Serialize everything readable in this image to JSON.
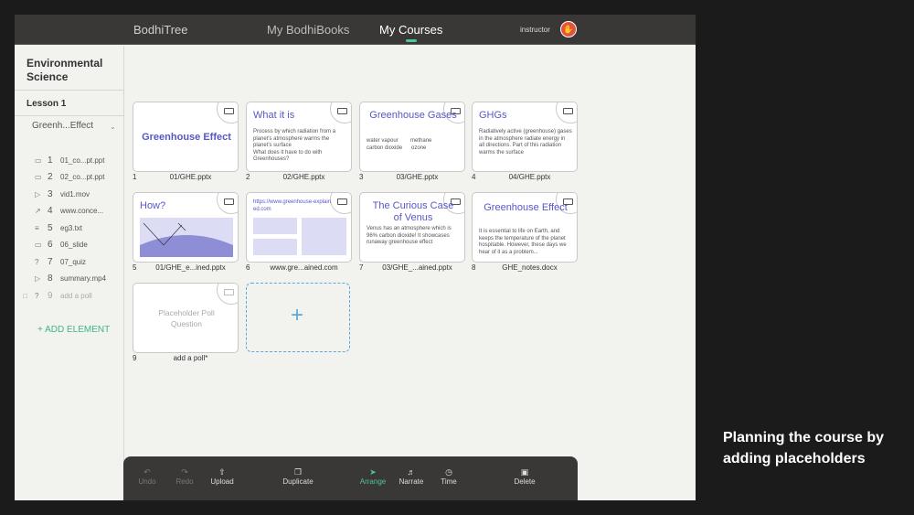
{
  "header": {
    "brand": "BodhiTree",
    "nav": [
      "My BodhiBooks",
      "My Courses"
    ],
    "user_label": "instructor"
  },
  "sidebar": {
    "course_title": "Environmental Science",
    "lesson": "Lesson 1",
    "group": "Greenh...Effect",
    "items": [
      {
        "num": "1",
        "label": "01_co...pt.ppt",
        "icon": "slides-icon"
      },
      {
        "num": "2",
        "label": "02_co...pt.ppt",
        "icon": "slides-icon"
      },
      {
        "num": "3",
        "label": "vid1.mov",
        "icon": "play-icon"
      },
      {
        "num": "4",
        "label": "www.conce...",
        "icon": "link-icon"
      },
      {
        "num": "5",
        "label": "eg3.txt",
        "icon": "text-icon"
      },
      {
        "num": "6",
        "label": "06_slide",
        "icon": "slides-icon"
      },
      {
        "num": "7",
        "label": "07_quiz",
        "icon": "quiz-icon"
      },
      {
        "num": "8",
        "label": "summary.mp4",
        "icon": "play-icon"
      },
      {
        "num": "9",
        "label": "add a poll",
        "icon": "quiz-icon"
      }
    ],
    "add_element": "+ ADD ELEMENT"
  },
  "cards": [
    {
      "num": "1",
      "name": "01/GHE.pptx",
      "title": "Greenhouse Effect",
      "body": ""
    },
    {
      "num": "2",
      "name": "02/GHE.pptx",
      "title": "What it is",
      "body": "Process by which radiation from a planet's atmosphere warms the planet's surface\nWhat does it have to do with Greenhouses?"
    },
    {
      "num": "3",
      "name": "03/GHE.pptx",
      "title": "Greenhouse Gases",
      "body": "water vapour        methane\ncarbon dioxide      ozone"
    },
    {
      "num": "4",
      "name": "04/GHE.pptx",
      "title": "GHGs",
      "body": "Radiatively active (greenhouse) gases in the atmosphere radiate energy in all directions. Part of this radiation warms the surface"
    },
    {
      "num": "5",
      "name": "01/GHE_e...ined.pptx",
      "title": "How?",
      "body": ""
    },
    {
      "num": "6",
      "name": "www.gre...ained.com",
      "title": "https://www.greenhouse-explained.com",
      "body": ""
    },
    {
      "num": "7",
      "name": "03/GHE_...ained.pptx",
      "title": "The Curious Case of Venus",
      "body": "Venus has an atmosphere which is 96% carbon dioxide! It showcases runaway greenhouse effect"
    },
    {
      "num": "8",
      "name": "GHE_notes.docx",
      "title": "Greenhouse Effect",
      "body": "It is essential to life on Earth, and keeps the temperature of the planet hospitable. However, these days we hear of it as a problem..."
    },
    {
      "num": "9",
      "name": "add a poll*",
      "title": "Placeholder Poll Question",
      "body": ""
    }
  ],
  "toolbar": [
    "Undo",
    "Redo",
    "Upload",
    "Duplicate",
    "Arrange",
    "Narrate",
    "Time",
    "Delete"
  ],
  "caption": "Planning the course by adding placeholders",
  "colors": {
    "accent": "#4cc59a",
    "slide_title": "#5757c9",
    "dark_bar": "#3a3837",
    "dashed": "#5aa9d9"
  }
}
